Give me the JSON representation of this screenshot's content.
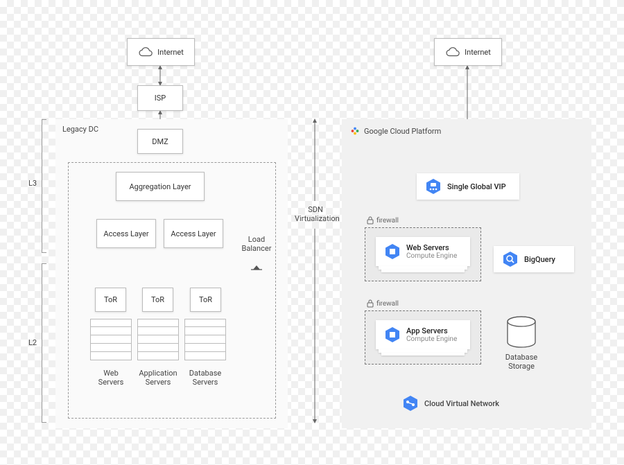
{
  "left": {
    "internet": "Internet",
    "isp": "ISP",
    "legacy_dc_label": "Legacy DC",
    "dmz": "DMZ",
    "aggregation": "Aggregation Layer",
    "access1": "Access Layer",
    "access2": "Access Layer",
    "load_balancer": "Load\nBalancer",
    "tor1": "ToR",
    "tor2": "ToR",
    "tor3": "ToR",
    "web_servers": "Web\nServers",
    "app_servers": "Application\nServers",
    "db_servers": "Database\nServers",
    "l3": "L3",
    "l2": "L2"
  },
  "middle": {
    "sdn": "SDN\nVirtualization"
  },
  "right": {
    "internet": "Internet",
    "gcp_label": "Google Cloud Platform",
    "vip": "Single Global VIP",
    "firewall1": "firewall",
    "web_servers_title": "Web Servers",
    "web_servers_sub": "Compute Engine",
    "firewall2": "firewall",
    "app_servers_title": "App Servers",
    "app_servers_sub": "Compute Engine",
    "bigquery": "BigQuery",
    "db_storage": "Database\nStorage",
    "cvn": "Cloud Virtual Network"
  }
}
